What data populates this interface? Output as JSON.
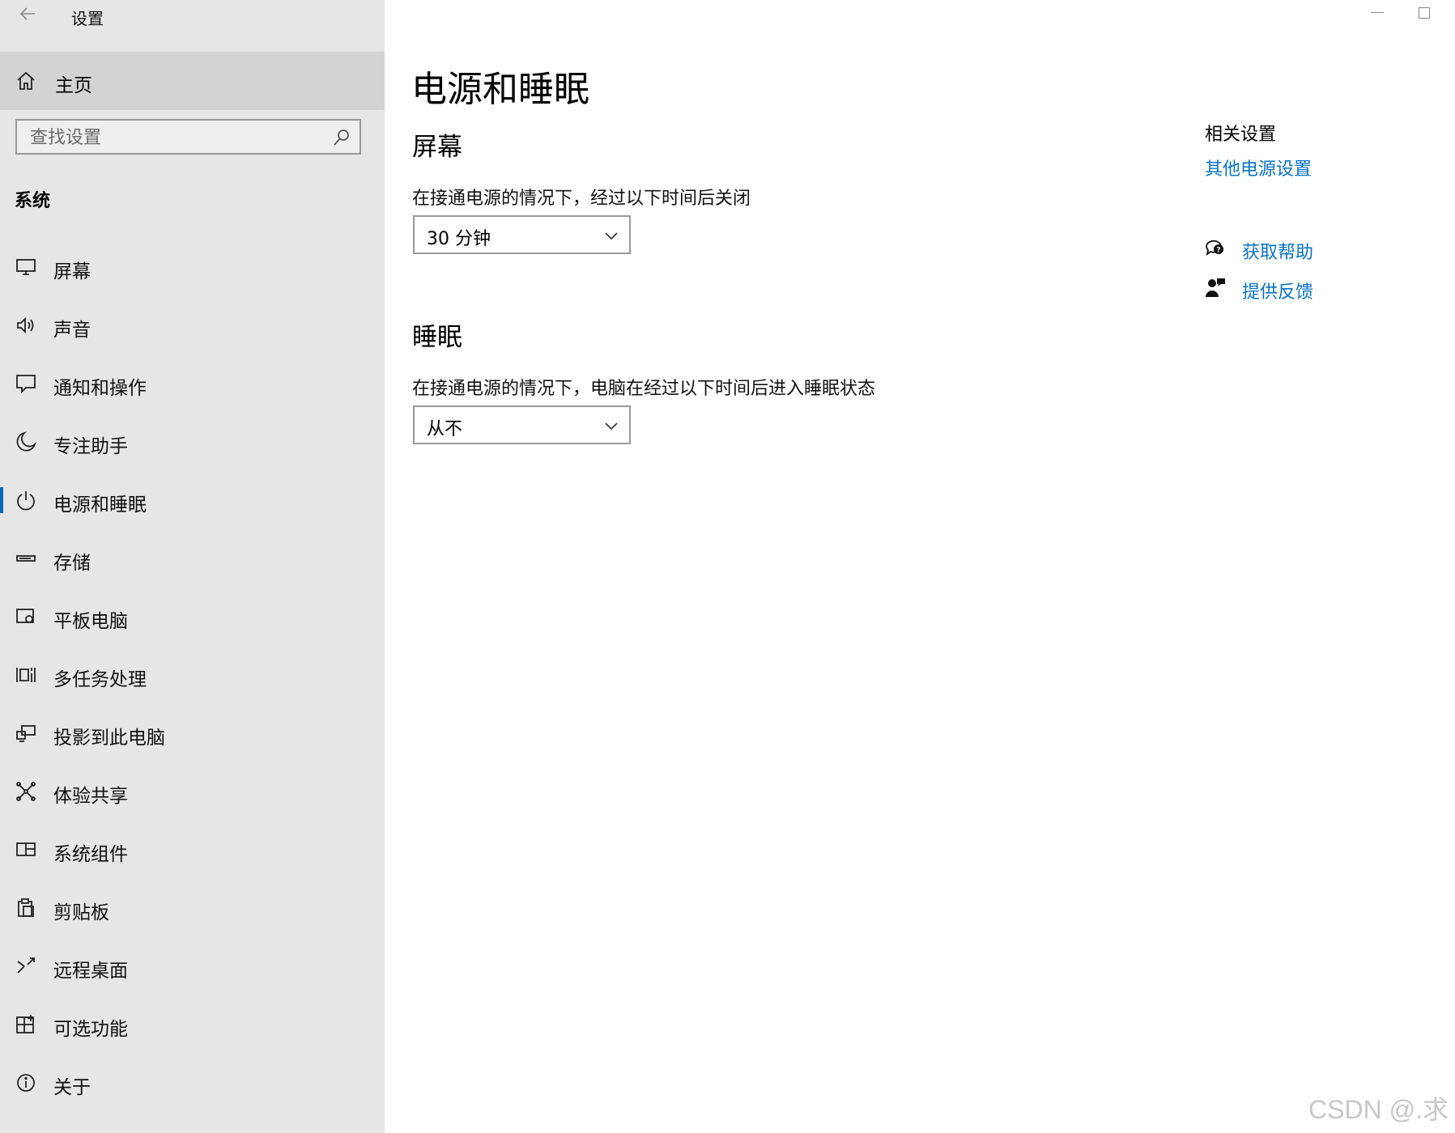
{
  "window": {
    "title": "设置"
  },
  "sidebar": {
    "home_label": "主页",
    "search_placeholder": "查找设置",
    "section_heading": "系统",
    "items": [
      {
        "label": "屏幕",
        "icon": "monitor-icon"
      },
      {
        "label": "声音",
        "icon": "speaker-icon"
      },
      {
        "label": "通知和操作",
        "icon": "notification-icon"
      },
      {
        "label": "专注助手",
        "icon": "moon-icon"
      },
      {
        "label": "电源和睡眠",
        "icon": "power-icon",
        "active": true
      },
      {
        "label": "存储",
        "icon": "storage-icon"
      },
      {
        "label": "平板电脑",
        "icon": "tablet-icon"
      },
      {
        "label": "多任务处理",
        "icon": "multitask-icon"
      },
      {
        "label": "投影到此电脑",
        "icon": "projection-icon"
      },
      {
        "label": "体验共享",
        "icon": "share-icon"
      },
      {
        "label": "系统组件",
        "icon": "components-icon"
      },
      {
        "label": "剪贴板",
        "icon": "clipboard-icon"
      },
      {
        "label": "远程桌面",
        "icon": "remote-desktop-icon"
      },
      {
        "label": "可选功能",
        "icon": "optional-features-icon"
      },
      {
        "label": "关于",
        "icon": "info-icon"
      }
    ]
  },
  "main": {
    "page_title": "电源和睡眠",
    "screen": {
      "heading": "屏幕",
      "description": "在接通电源的情况下，经过以下时间后关闭",
      "value": "30 分钟"
    },
    "sleep": {
      "heading": "睡眠",
      "description": "在接通电源的情况下，电脑在经过以下时间后进入睡眠状态",
      "value": "从不"
    },
    "related": {
      "heading": "相关设置",
      "link": "其他电源设置"
    },
    "help": {
      "get_help": "获取帮助",
      "feedback": "提供反馈"
    }
  },
  "watermark": "CSDN @.求",
  "colors": {
    "sidebar_bg": "#e6e6e6",
    "home_bg": "#d3d3d3",
    "link": "#0a74c4",
    "accent": "#0067c0"
  }
}
